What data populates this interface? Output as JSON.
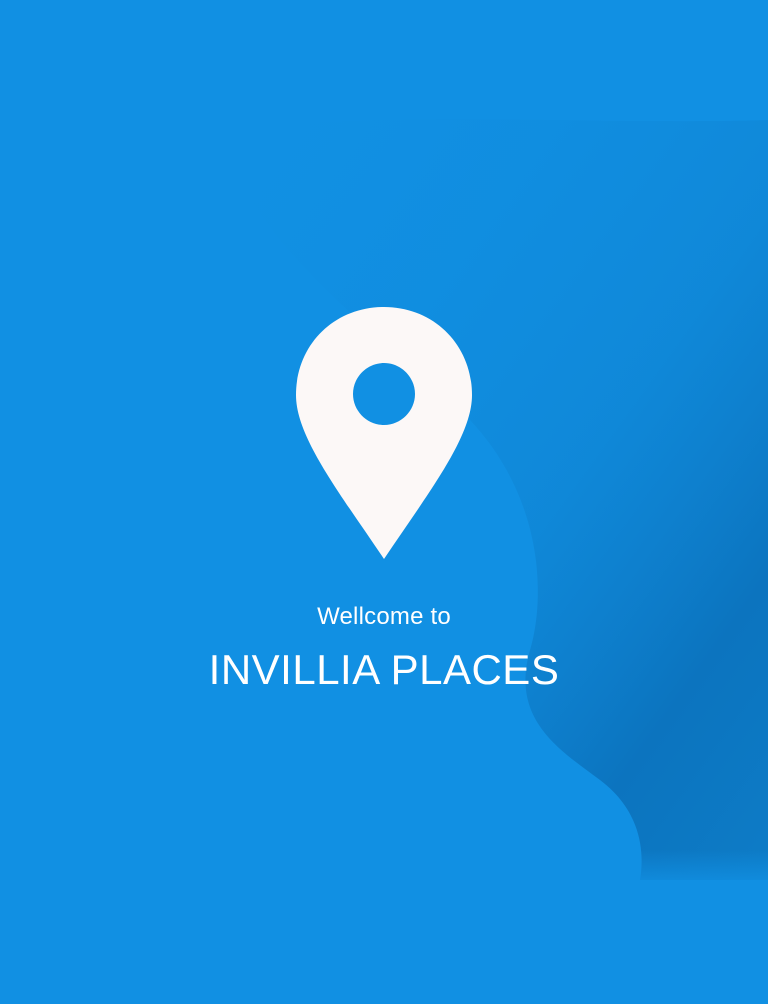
{
  "splash": {
    "welcome_text": "Wellcome to",
    "app_name": "INVILLIA PLACES",
    "logo_icon": "location-pin-icon"
  },
  "colors": {
    "background": "#1190e3",
    "wave_shadow": "#0b6fb5",
    "pin": "#fcf8f7",
    "text": "#ffffff"
  }
}
